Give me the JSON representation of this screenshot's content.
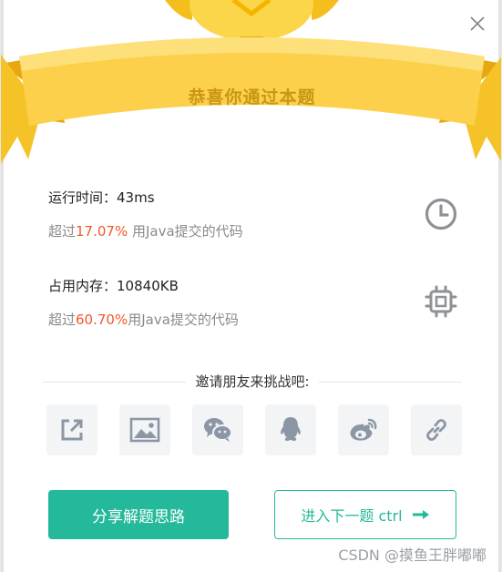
{
  "banner": {
    "title": "恭喜你通过本题"
  },
  "stats": {
    "runtime": {
      "label": "运行时间：",
      "value": "43ms",
      "prefix": "超过",
      "percent": "17.07%",
      "suffix": " 用Java提交的代码"
    },
    "memory": {
      "label": "占用内存：",
      "value": "10840KB",
      "prefix": "超过",
      "percent": "60.70%",
      "suffix": "用Java提交的代码"
    }
  },
  "invite": {
    "text": "邀请朋友来挑战吧:"
  },
  "actions": {
    "share_solution": "分享解题思路",
    "next_problem": "进入下一题 ctrl"
  },
  "watermark": "CSDN @摸鱼王胖嘟嘟",
  "colors": {
    "accent": "#23b99a",
    "percent": "#f1592a",
    "banner": "#f7c21a"
  },
  "icons": [
    "close-icon",
    "clock-icon",
    "chip-icon",
    "external-share-icon",
    "image-icon",
    "wechat-icon",
    "qq-icon",
    "weibo-icon",
    "link-icon",
    "arrow-right-icon"
  ]
}
